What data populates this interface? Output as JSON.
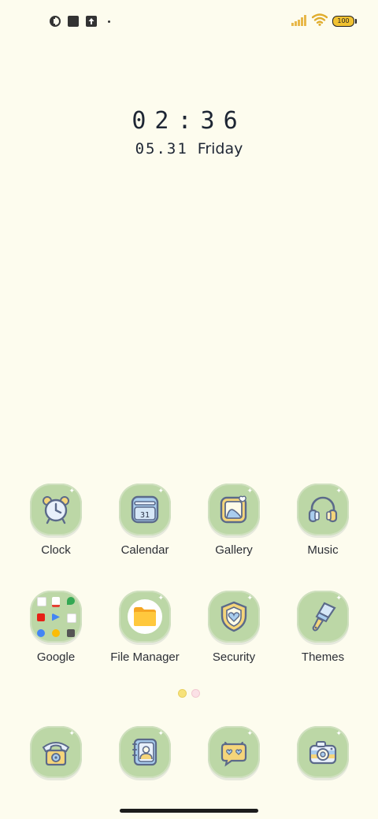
{
  "status_bar": {
    "battery_level": "100",
    "icons": [
      "data-saver-icon",
      "square-app-icon",
      "upload-icon",
      "more-dot-icon",
      "signal-icon",
      "wifi-icon",
      "battery-icon"
    ]
  },
  "clock_widget": {
    "time": "02:36",
    "date": "05.31",
    "weekday": "Friday"
  },
  "apps_row1": [
    {
      "label": "Clock",
      "icon": "alarm-clock-icon"
    },
    {
      "label": "Calendar",
      "icon": "calendar-icon",
      "day": "31"
    },
    {
      "label": "Gallery",
      "icon": "gallery-icon"
    },
    {
      "label": "Music",
      "icon": "headphones-icon"
    }
  ],
  "apps_row2": [
    {
      "label": "Google",
      "icon": "google-folder-icon"
    },
    {
      "label": "File Manager",
      "icon": "folder-icon"
    },
    {
      "label": "Security",
      "icon": "shield-icon"
    },
    {
      "label": "Themes",
      "icon": "paint-brush-icon"
    }
  ],
  "dock": [
    {
      "icon": "phone-icon"
    },
    {
      "icon": "contacts-icon"
    },
    {
      "icon": "messages-icon"
    },
    {
      "icon": "camera-icon"
    }
  ],
  "colors": {
    "background": "#fdfcee",
    "tile": "#bcd7a6",
    "accent_yellow": "#f5d57a",
    "accent_blue": "#9fc3e6"
  }
}
